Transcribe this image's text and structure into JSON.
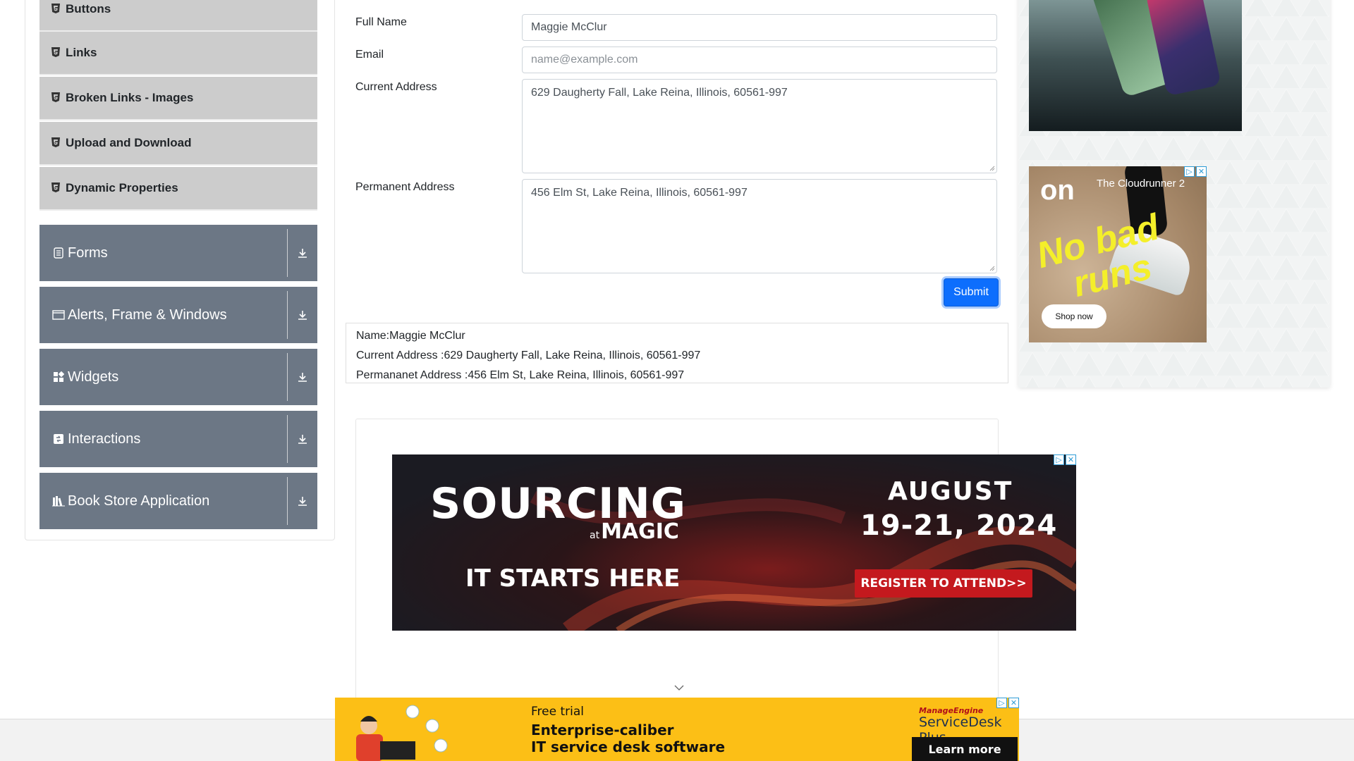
{
  "sidebar": {
    "sub_items": [
      {
        "label": "Buttons"
      },
      {
        "label": "Links"
      },
      {
        "label": "Broken Links - Images"
      },
      {
        "label": "Upload and Download"
      },
      {
        "label": "Dynamic Properties"
      }
    ],
    "groups": [
      {
        "label": "Forms",
        "icon": "form-icon"
      },
      {
        "label": "Alerts, Frame & Windows",
        "icon": "window-icon"
      },
      {
        "label": "Widgets",
        "icon": "widgets-icon"
      },
      {
        "label": "Interactions",
        "icon": "interactions-icon"
      },
      {
        "label": "Book Store Application",
        "icon": "books-icon"
      }
    ]
  },
  "form": {
    "full_name_label": "Full Name",
    "full_name_value": "Maggie McClur",
    "email_label": "Email",
    "email_placeholder": "name@example.com",
    "current_address_label": "Current Address",
    "current_address_value": "629 Daugherty Fall, Lake Reina, Illinois, 60561-997",
    "permanent_address_label": "Permanent Address",
    "permanent_address_value": "456 Elm St, Lake Reina, Illinois, 60561-997",
    "submit_label": "Submit"
  },
  "output": {
    "name": "Name:Maggie McClur",
    "current_address": "Current Address :629 Daugherty Fall, Lake Reina, Illinois, 60561-997",
    "permanent_address": "Permananet Address :456 Elm St, Lake Reina, Illinois, 60561-997"
  },
  "ads": {
    "shoe": {
      "headline": "The Cloudrunner 2",
      "slogan_line1": "No bad",
      "slogan_line2": "runs",
      "cta": "Shop now",
      "brand": "on"
    },
    "sourcing": {
      "title": "SOURCING",
      "at": "at",
      "magic": "MAGIC",
      "tagline": "IT STARTS HERE",
      "date_month": "AUGUST",
      "date_days": "19-21, 2024",
      "cta": "REGISTER TO ATTEND>>"
    },
    "servicedesk": {
      "line1": "Free trial",
      "line2": "Enterprise-caliber",
      "line3": "IT service desk software",
      "brand_top": "ManageEngine",
      "brand_name": "ServiceDesk Plus",
      "cta": "Learn more"
    },
    "adchoices_glyph": "▷",
    "close_glyph": "✕"
  },
  "colors": {
    "group_bg": "#6c7785",
    "sub_item_bg": "#cccccc",
    "submit_bg": "#0d6efd",
    "ad_yellow": "#fcbf16",
    "register_red": "#c4191e"
  }
}
